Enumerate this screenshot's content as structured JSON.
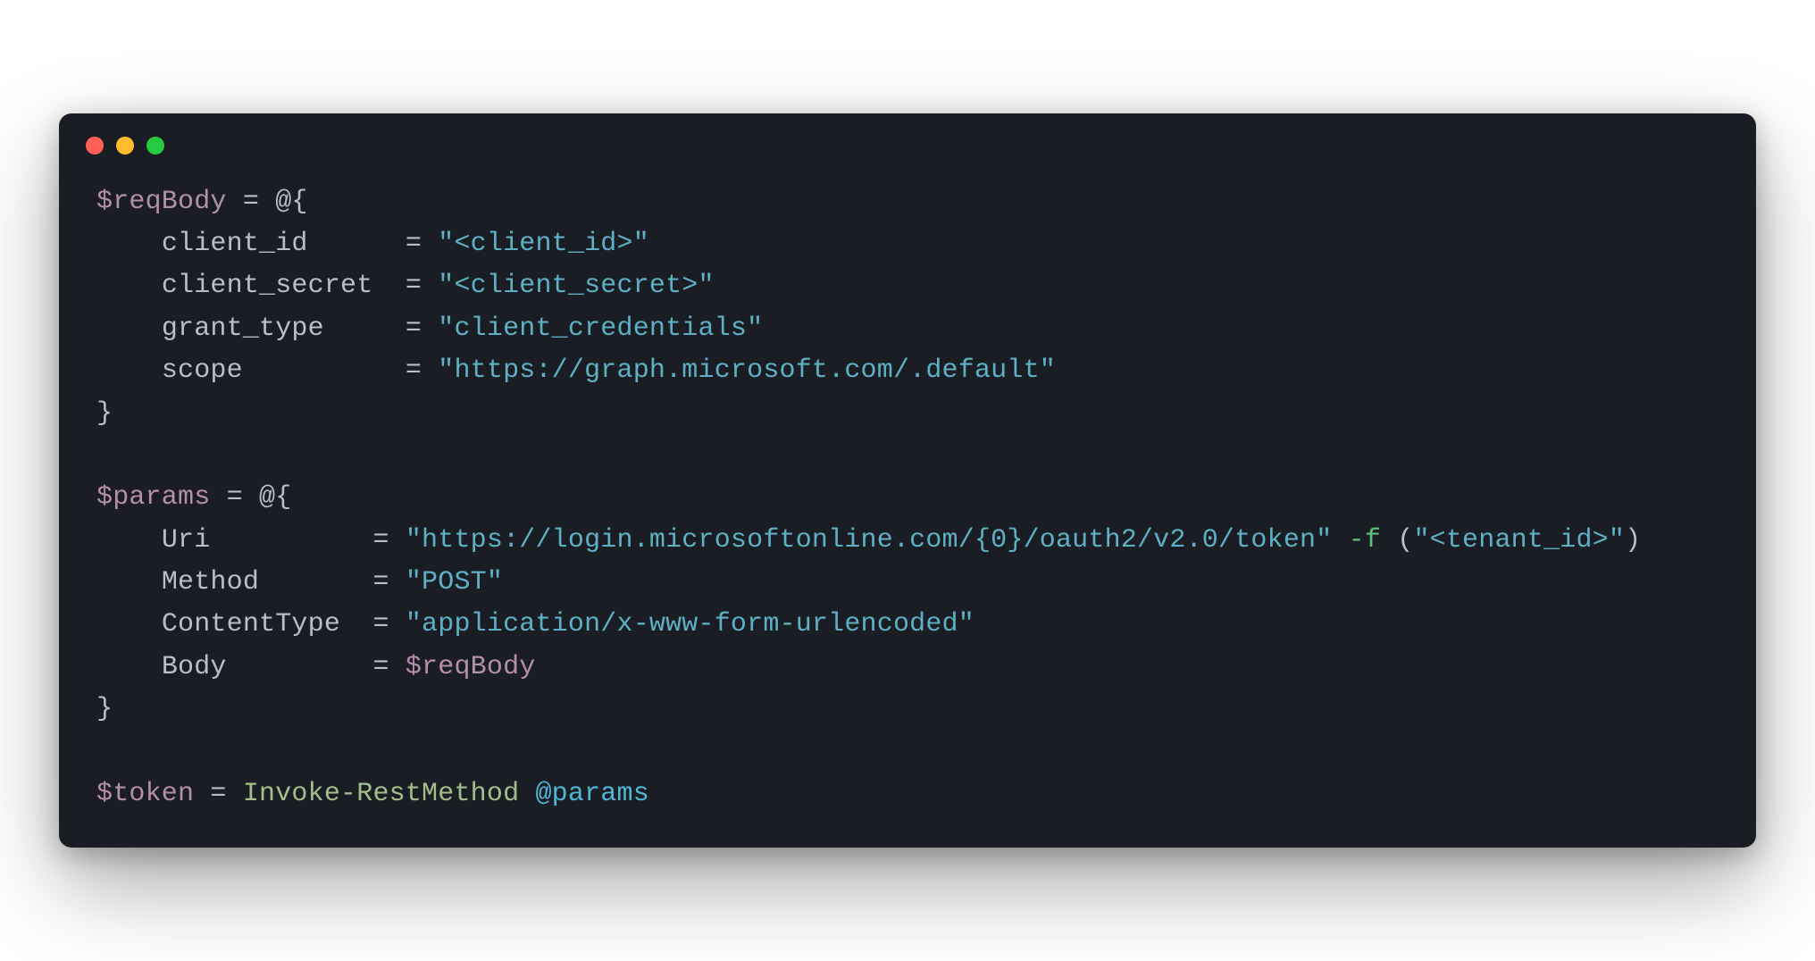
{
  "code": {
    "var_reqBody": "$reqBody",
    "var_params": "$params",
    "var_token": "$token",
    "eq": " = ",
    "at_open": "@{",
    "close_brace": "}",
    "reqBody": {
      "k_client_id": "client_id",
      "k_client_secret": "client_secret",
      "k_grant_type": "grant_type",
      "k_scope": "scope",
      "v_client_id": "\"<client_id>\"",
      "v_client_secret": "\"<client_secret>\"",
      "v_grant_type": "\"client_credentials\"",
      "v_scope": "\"https://graph.microsoft.com/.default\""
    },
    "params": {
      "k_uri": "Uri",
      "k_method": "Method",
      "k_contentType": "ContentType",
      "k_body": "Body",
      "v_uri": "\"https://login.microsoftonline.com/{0}/oauth2/v2.0/token\"",
      "f_op": "-f",
      "lparen": "(",
      "v_tenant": "\"<tenant_id>\"",
      "rparen": ")",
      "v_method": "\"POST\"",
      "v_contentType": "\"application/x-www-form-urlencoded\"",
      "v_body": "$reqBody"
    },
    "invoke": {
      "cmdlet": "Invoke-RestMethod",
      "splat": "@params"
    },
    "pad": {
      "indent": "    ",
      "reqBody_client_id": "     ",
      "reqBody_client_secret": " ",
      "reqBody_grant_type": "    ",
      "reqBody_scope": "         ",
      "params_uri": "         ",
      "params_method": "      ",
      "params_contentType": " ",
      "params_body": "        "
    }
  }
}
